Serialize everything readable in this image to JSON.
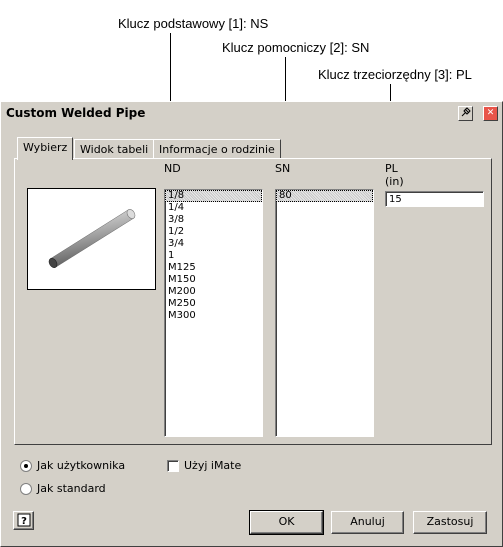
{
  "annotations": {
    "primary_key": "Klucz podstawowy [1]: NS",
    "secondary_key": "Klucz pomocniczy [2]: SN",
    "tertiary_key": "Klucz trzeciorzędny [3]: PL"
  },
  "window": {
    "title": "Custom Welded Pipe",
    "help_icon": "help-pin-icon",
    "close_icon": "close-icon"
  },
  "tabs": [
    {
      "label": "Wybierz",
      "active": true
    },
    {
      "label": "Widok tabeli",
      "active": false
    },
    {
      "label": "Informacje o rodzinie",
      "active": false
    }
  ],
  "columns": {
    "nd": {
      "header": "ND",
      "items": [
        "1/8",
        "1/4",
        "3/8",
        "1/2",
        "3/4",
        "1",
        "M125",
        "M150",
        "M200",
        "M250",
        "M300"
      ],
      "selected": "1/8"
    },
    "sn": {
      "header": "SN",
      "items": [
        "80"
      ],
      "selected": "80"
    },
    "pl": {
      "header": "PL",
      "unit": "(in)",
      "value": "15"
    }
  },
  "options": {
    "as_user": "Jak użytkownika",
    "as_standard": "Jak standard",
    "use_imate": "Użyj iMate",
    "selected_option": "as_user",
    "use_imate_checked": false
  },
  "buttons": {
    "ok": "OK",
    "cancel": "Anuluj",
    "apply": "Zastosuj",
    "help_icon": "help-icon"
  }
}
